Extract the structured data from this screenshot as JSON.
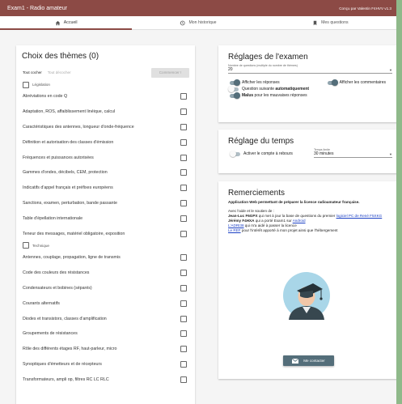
{
  "app": {
    "title": "Exam1 - Radio amateur",
    "credit": "Conçu par Valentin F4HVV  v1.3"
  },
  "tabs": [
    {
      "label": "Accueil",
      "icon": "home-icon",
      "active": true
    },
    {
      "label": "Mon historique",
      "icon": "history-icon",
      "active": false
    },
    {
      "label": "Mes questions",
      "icon": "bookmark-icon",
      "active": false
    }
  ],
  "themes": {
    "title": "Choix des thèmes (0)",
    "check_all": "Tout cocher",
    "uncheck_all": "Tout décocher",
    "start": "Commencer !",
    "legislation_label": "Législation",
    "legislation_items": [
      "Abréviations en code Q",
      "Adaptation, ROS, affaiblissement linéique, calcul",
      "Caractéristiques des antennes, longueur d'onde-fréquence",
      "Définition et autorisation des classes d'émission",
      "Fréquences et puissances autorisées",
      "Gammes d'ondes, décibels, CEM, protection",
      "Indicatifs d'appel français et préfixes européens",
      "Sanctions, examen, perturbation, bande passante",
      "Table d'épellation internationale",
      "Teneur des messages, matériel obligatoire, exposition"
    ],
    "technique_label": "Technique",
    "technique_items": [
      "Antennes, couplage, propagation, ligne de transmis",
      "Code des couleurs des résistances",
      "Condensateurs et bobines (séparés)",
      "Courants alternatifs",
      "Diodes et transistors, classes d'amplification",
      "Groupements de résistances",
      "Rôle des différents étages RF, haut-parleur, micro",
      "Synoptiques d'émetteurs et de récepteurs",
      "Transformateurs, ampli op, filtres RC LC RLC"
    ]
  },
  "exam_settings": {
    "title": "Réglages de l'examen",
    "count_label": "Nombre de questions (multiple du nombre de thèmes)",
    "count_value": "20",
    "show_answers": "Afficher les réponses",
    "show_comments": "Afficher les commentaires",
    "next_question_prefix": "Question suivante ",
    "next_question_bold": "automatiquement",
    "malus_bold": "Malus",
    "malus_rest": " pour les mauvaises réponses"
  },
  "time_settings": {
    "title": "Réglage du temps",
    "countdown_label": "Activer le compte à rebours",
    "limit_label": "Temps limite",
    "limit_value": "30 minutes"
  },
  "thanks": {
    "title": "Remerciements",
    "intro": "Application Web permettant de préparer la licence radioamateur française.",
    "support": "Avec l'aide et le soutien de :",
    "l1_name": "Jean-Luc F6GPX",
    "l1_text": " qui met à jour la base de questions du premier ",
    "l1_link": "logiciel PC de René F5XKG",
    "l2_name": "Jérémy F4HXA",
    "l2_text": " qui a porté Exam1 sur ",
    "l2_link": "Android",
    "l3_link": "L'ADRI38",
    "l3_text": " qui m'a aidé à passer la licence",
    "l4_link": "Le REF",
    "l4_text": " pour l'intérêt apporté à mon projet ainsi que l'hébergement",
    "contact": "Me contacter"
  }
}
